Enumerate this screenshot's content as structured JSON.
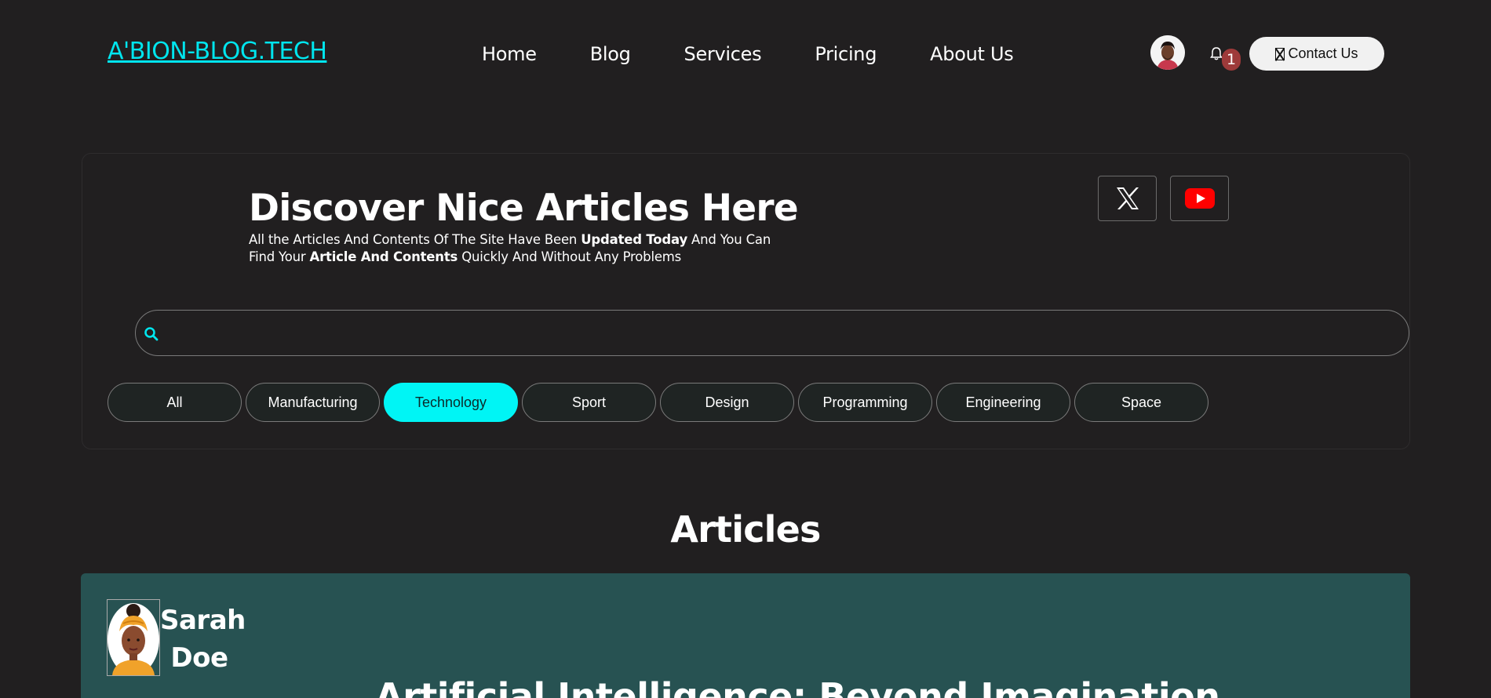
{
  "header": {
    "logo": "A'BION-BLOG.TECH",
    "nav": [
      "Home",
      "Blog",
      "Services",
      "Pricing",
      "About Us"
    ],
    "notification_count": "1",
    "contact_label": "Contact Us"
  },
  "hero": {
    "title": "Discover Nice Articles Here",
    "desc_1": "All the Articles And Contents Of The Site Have Been ",
    "desc_bold_1": "Updated Today",
    "desc_2": " And You Can Find Your ",
    "desc_bold_2": "Article And Contents",
    "desc_3": " Quickly And Without Any Problems",
    "social": [
      "x-icon",
      "youtube-icon"
    ]
  },
  "search": {
    "placeholder": ""
  },
  "categories": {
    "items": [
      "All",
      "Manufacturing",
      "Technology",
      "Sport",
      "Design",
      "Programming",
      "Engineering",
      "Space"
    ],
    "active": "Technology"
  },
  "articles": {
    "heading": "Articles",
    "items": [
      {
        "author": "Sarah Doe",
        "title": "Artificial Intelligence: Beyond Imagination"
      }
    ]
  },
  "colors": {
    "background": "#211f20",
    "accent": "#00f5f5",
    "card": "#275252",
    "badge": "#9e3a3a"
  }
}
